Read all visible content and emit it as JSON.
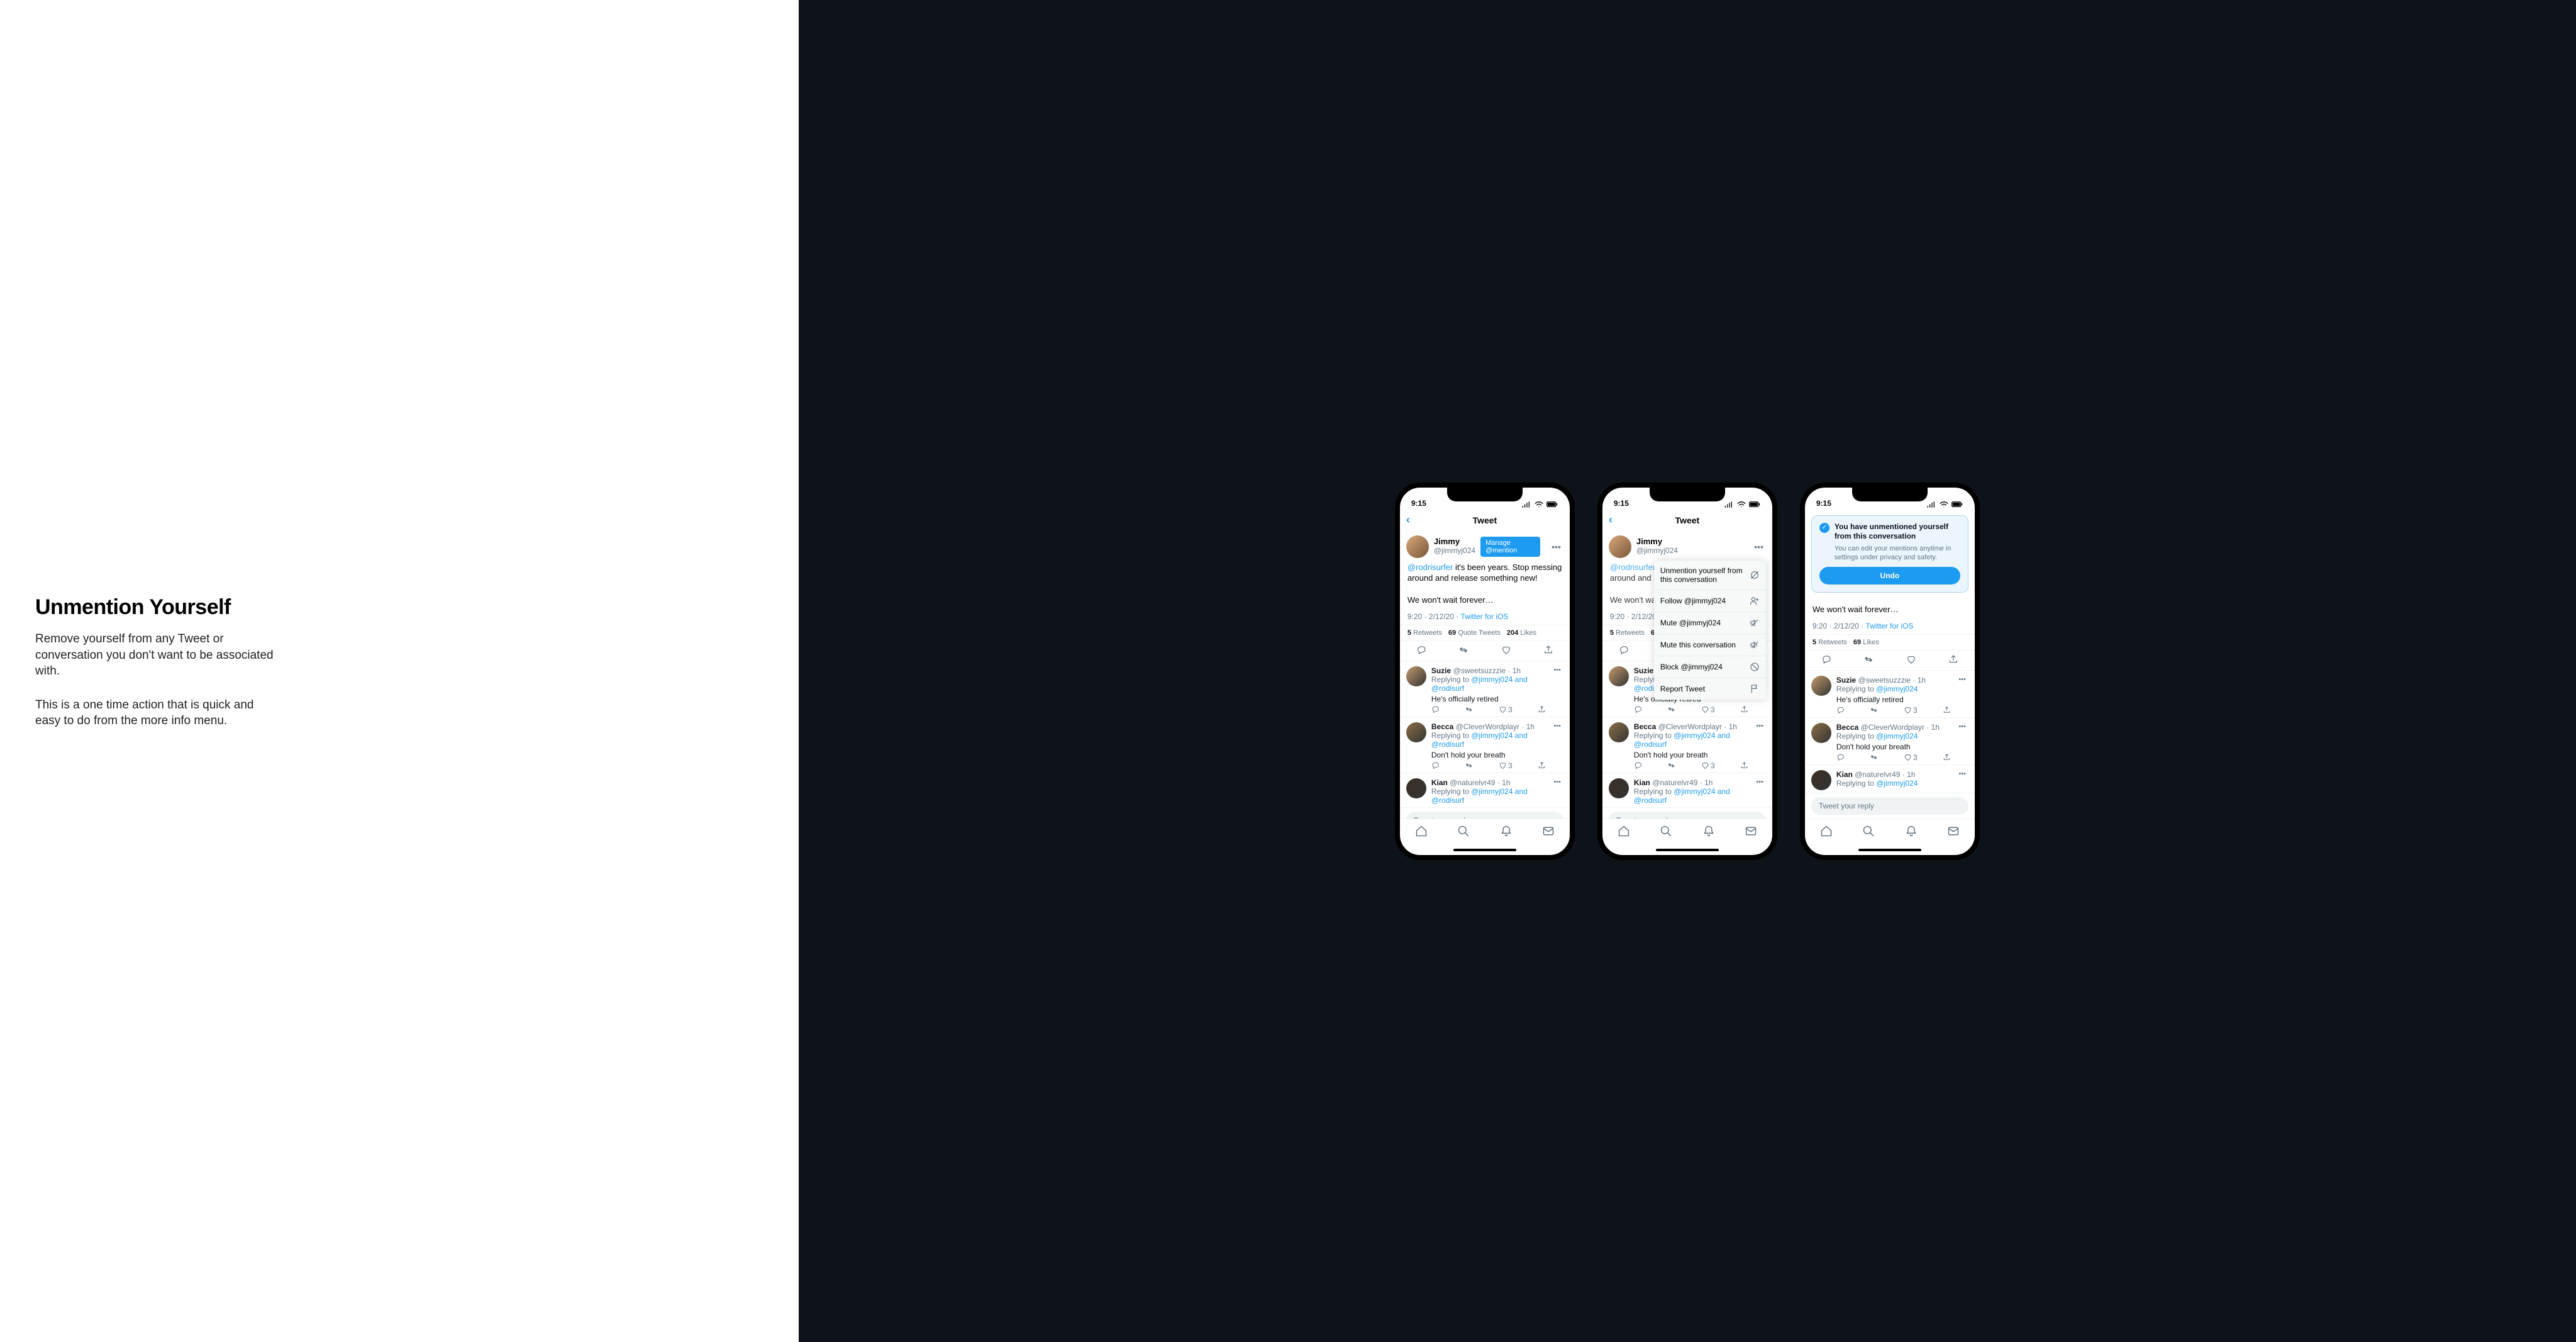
{
  "left": {
    "title": "Unmention Yourself",
    "p1": "Remove yourself from any Tweet or conversation you don't want to be associated with.",
    "p2": "This is a one time action that is quick and easy to do from the more info menu."
  },
  "status": {
    "time": "9:15"
  },
  "header": {
    "title": "Tweet"
  },
  "tweet": {
    "author_name": "Jimmy",
    "author_handle": "@jimmyj024",
    "badge": "Manage @mention",
    "mention": "@rodrisurfer",
    "text_after_mention": " it's been years. Stop messing around and release something new!",
    "text_line2": "We won't wait forever…",
    "time": "9:20",
    "date": "2/12/20",
    "source": "Twitter for iOS"
  },
  "stats": {
    "retweets_n": "5",
    "retweets_l": "Retweets",
    "quotes_n": "69",
    "quotes_l": "Quote Tweets",
    "likes_n": "204",
    "likes_l": "Likes",
    "likes3_n": "69",
    "likes3_l": "Likes"
  },
  "ctx": {
    "unmention": "Unmention yourself from this conversation",
    "follow": "Follow @jimmyj024",
    "mute_user": "Mute @jimmyj024",
    "mute_conv": "Mute this conversation",
    "block": "Block @jimmyj024",
    "report": "Report Tweet"
  },
  "toast": {
    "title": "You have unmentioned yourself from this conversation",
    "sub": "You can edit your mentions anytime in settings under privacy and safety.",
    "undo": "Undo"
  },
  "replies": [
    {
      "name": "Suzie",
      "handle": "@sweetsuzzzie",
      "time": "1h",
      "to_full": "@jimmyj024 and @rodisurf",
      "to_self": "@jimmyj024",
      "text": "He's officially retired",
      "likes": "3"
    },
    {
      "name": "Becca",
      "handle": "@CleverWordplayr",
      "time": "1h",
      "to_full": "@jimmyj024 and @rodisurf",
      "to_self": "@jimmyj024",
      "text": "Don't hold your breath",
      "likes": "3"
    },
    {
      "name": "Kian",
      "handle": "@naturelvr49",
      "time": "1h",
      "to_full": "@jimmyj024 and @rodisurf",
      "to_self": "@jimmyj024",
      "text": "",
      "likes": ""
    }
  ],
  "compose": "Tweet your reply",
  "replying_to": "Replying to "
}
